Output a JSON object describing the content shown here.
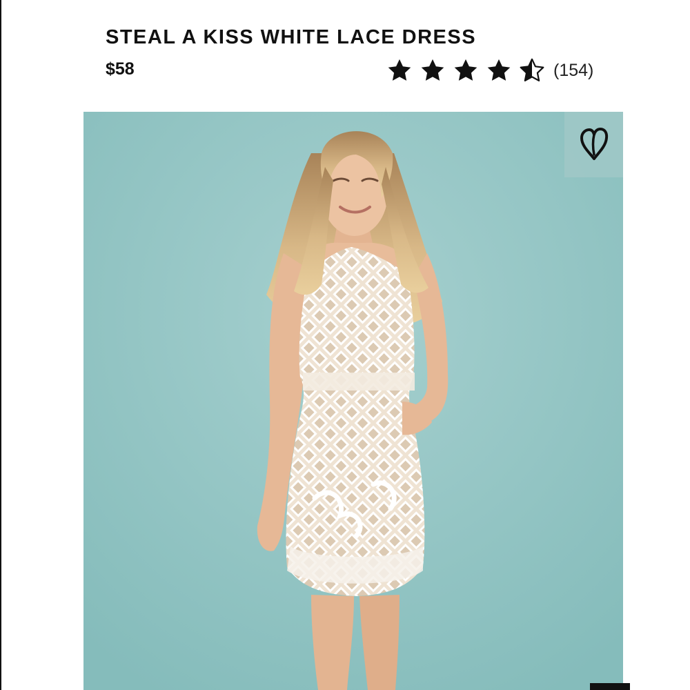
{
  "product": {
    "title": "STEAL A KISS WHITE LACE DRESS",
    "price": "$58",
    "rating": {
      "stars": 4.5,
      "max_stars": 5,
      "review_count_text": "(154)"
    }
  },
  "image": {
    "background_color": "#8fc3c2",
    "description_icon": "product-photo"
  },
  "wishlist": {
    "icon": "heart-outline-icon"
  }
}
